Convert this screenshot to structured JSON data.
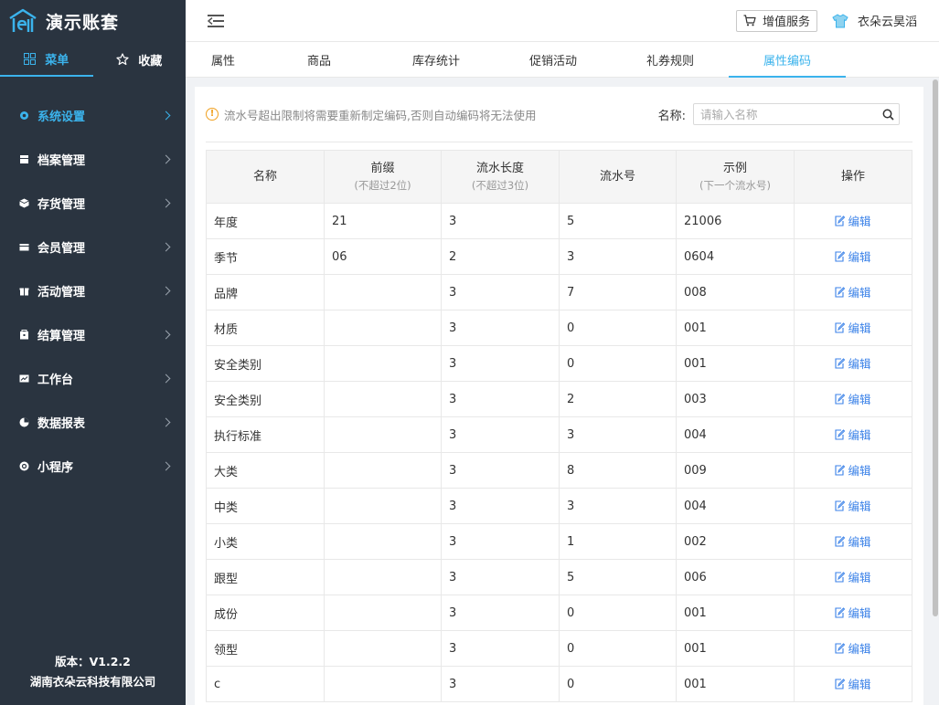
{
  "brand": {
    "title": "演示账套"
  },
  "sidebar": {
    "tabs": [
      {
        "label": "菜单",
        "icon": "grid-icon"
      },
      {
        "label": "收藏",
        "icon": "star-icon"
      }
    ],
    "items": [
      {
        "label": "系统设置",
        "icon": "settings-icon",
        "active": true
      },
      {
        "label": "档案管理",
        "icon": "archive-icon"
      },
      {
        "label": "存货管理",
        "icon": "inventory-icon"
      },
      {
        "label": "会员管理",
        "icon": "member-card-icon"
      },
      {
        "label": "活动管理",
        "icon": "gift-icon"
      },
      {
        "label": "结算管理",
        "icon": "settlement-icon"
      },
      {
        "label": "工作台",
        "icon": "chart-icon"
      },
      {
        "label": "数据报表",
        "icon": "pie-icon"
      },
      {
        "label": "小程序",
        "icon": "miniapp-icon"
      }
    ],
    "footer": {
      "version": "版本：V1.2.2",
      "company": "湖南衣朵云科技有限公司"
    }
  },
  "header": {
    "value_added_label": "增值服务",
    "user_name": "衣朵云昊滔"
  },
  "tabs": [
    {
      "label": "属性"
    },
    {
      "label": "商品"
    },
    {
      "label": "库存统计"
    },
    {
      "label": "促销活动"
    },
    {
      "label": "礼券规则"
    },
    {
      "label": "属性编码",
      "active": true
    }
  ],
  "notice": {
    "text": "流水号超出限制将需要重新制定编码,否则自动编码将无法使用"
  },
  "search": {
    "label": "名称:",
    "placeholder": "请输入名称"
  },
  "table": {
    "headers": [
      {
        "title": "名称",
        "sub": ""
      },
      {
        "title": "前缀",
        "sub": "(不超过2位)"
      },
      {
        "title": "流水长度",
        "sub": "(不超过3位)"
      },
      {
        "title": "流水号",
        "sub": ""
      },
      {
        "title": "示例",
        "sub": "(下一个流水号)"
      },
      {
        "title": "操作",
        "sub": ""
      }
    ],
    "edit_label": "编辑",
    "rows": [
      [
        "年度",
        "21",
        "3",
        "5",
        "21006"
      ],
      [
        "季节",
        "06",
        "2",
        "3",
        "0604"
      ],
      [
        "品牌",
        "",
        "3",
        "7",
        "008"
      ],
      [
        "材质",
        "",
        "3",
        "0",
        "001"
      ],
      [
        "安全类别",
        "",
        "3",
        "0",
        "001"
      ],
      [
        "安全类别",
        "",
        "3",
        "2",
        "003"
      ],
      [
        "执行标准",
        "",
        "3",
        "3",
        "004"
      ],
      [
        "大类",
        "",
        "3",
        "8",
        "009"
      ],
      [
        "中类",
        "",
        "3",
        "3",
        "004"
      ],
      [
        "小类",
        "",
        "3",
        "1",
        "002"
      ],
      [
        "跟型",
        "",
        "3",
        "5",
        "006"
      ],
      [
        "成份",
        "",
        "3",
        "0",
        "001"
      ],
      [
        "领型",
        "",
        "3",
        "0",
        "001"
      ],
      [
        "c",
        "",
        "3",
        "0",
        "001"
      ]
    ]
  },
  "colors": {
    "accent": "#3bb3ec",
    "link": "#3b82e8",
    "sidebar_bg": "#2a3440",
    "warning": "#f0a020"
  }
}
